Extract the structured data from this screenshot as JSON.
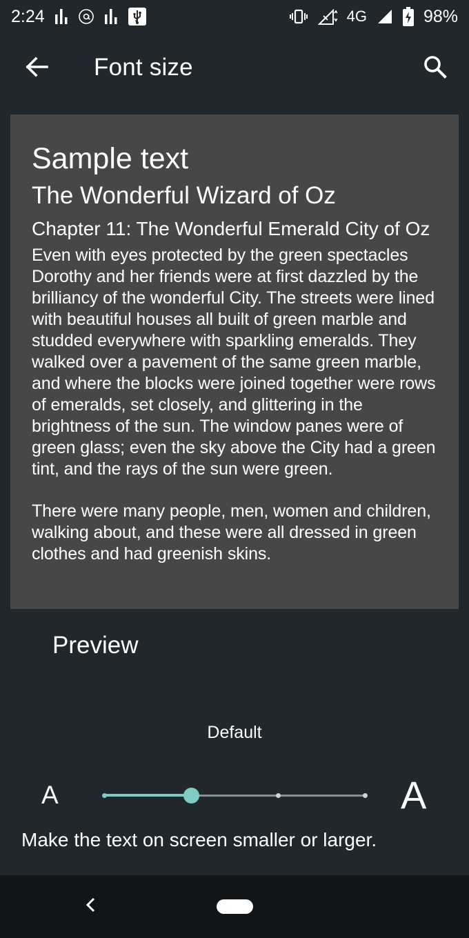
{
  "status_bar": {
    "time": "2:24",
    "network_type": "4G",
    "battery": "98%",
    "left_icons": [
      "signal-bars-icon",
      "at-circle-icon",
      "signal-bars-icon",
      "usb-icon"
    ],
    "right_icons": [
      "vibrate-icon",
      "mobile-data-icon",
      "cell-signal-icon",
      "battery-charging-icon"
    ]
  },
  "app_bar": {
    "title": "Font size",
    "back_icon": "arrow-back-icon",
    "search_icon": "search-icon"
  },
  "preview": {
    "sample_heading": "Sample text",
    "book_title": "The Wonderful Wizard of Oz",
    "chapter_title": "Chapter 11: The Wonderful Emerald City of Oz",
    "paragraphs": [
      "Even with eyes protected by the green spectacles Dorothy and her friends were at first dazzled by the brilliancy of the wonderful City. The streets were lined with beautiful houses all built of green marble and studded everywhere with sparkling emeralds. They walked over a pavement of the same green marble, and where the blocks were joined together were rows of emeralds, set closely, and glittering in the brightness of the sun. The window panes were of green glass; even the sky above the City had a green tint, and the rays of the sun were green.",
      "There were many people, men, women and children, walking about, and these were all dressed in green clothes and had greenish skins."
    ],
    "label": "Preview"
  },
  "font_size": {
    "current_label": "Default",
    "small_glyph": "A",
    "large_glyph": "A",
    "steps": 4,
    "selected_index": 1,
    "hint": "Make the text on screen smaller or larger."
  },
  "colors": {
    "background": "#22272b",
    "card": "#474747",
    "accent": "#80cbc4",
    "nav_bar": "#121517"
  },
  "nav_bar": {
    "back_icon": "nav-back-icon",
    "home_icon": "home-pill-icon"
  }
}
